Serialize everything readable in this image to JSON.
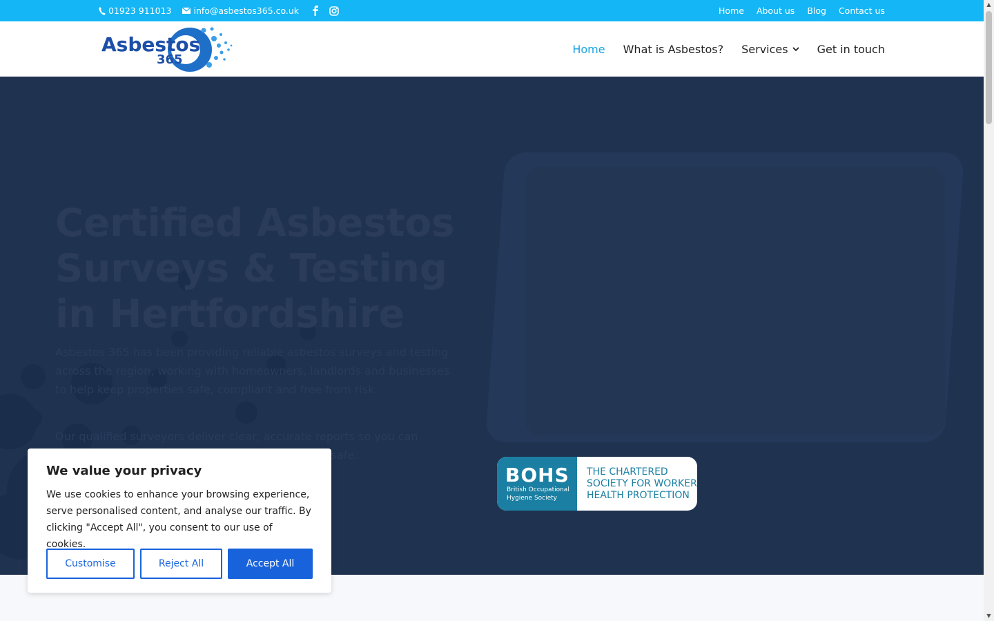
{
  "topbar": {
    "phone": "01923 911013",
    "email": "info@asbestos365.co.uk",
    "links": [
      "Home",
      "About us",
      "Blog",
      "Contact us"
    ]
  },
  "logo": {
    "line1": "Asbestos",
    "line2": "365"
  },
  "nav": {
    "items": [
      "Home",
      "What is Asbestos?",
      "Services",
      "Get in touch"
    ]
  },
  "hero": {
    "title": "Certified Asbestos Surveys & Testing in Hertfordshire",
    "paragraph1": "Asbestos 365 has been providing reliable asbestos surveys and testing across the region, working with homeowners, landlords and businesses to help keep properties safe, compliant and free from risk.",
    "paragraph2": "Our qualified surveyors deliver clear, accurate reports so you can manage asbestos confidently and keep everyone safe."
  },
  "bohs": {
    "letters": "BOHS",
    "org_line1": "British Occupational",
    "org_line2": "Hygiene Society",
    "tag1": "THE CHARTERED",
    "tag2": "SOCIETY FOR WORKER",
    "tag3": "HEALTH PROTECTION"
  },
  "cookie": {
    "title": "We value your privacy",
    "body": "We use cookies to enhance your browsing experience, serve personalised content, and analyse our traffic. By clicking \"Accept All\", you consent to our use of cookies.",
    "customise": "Customise",
    "reject": "Reject All",
    "accept": "Accept All"
  },
  "colors": {
    "topbar": "#14b6f5",
    "hero": "#1f3250",
    "accent": "#1aa3e0",
    "cookie_button": "#1863dc"
  }
}
